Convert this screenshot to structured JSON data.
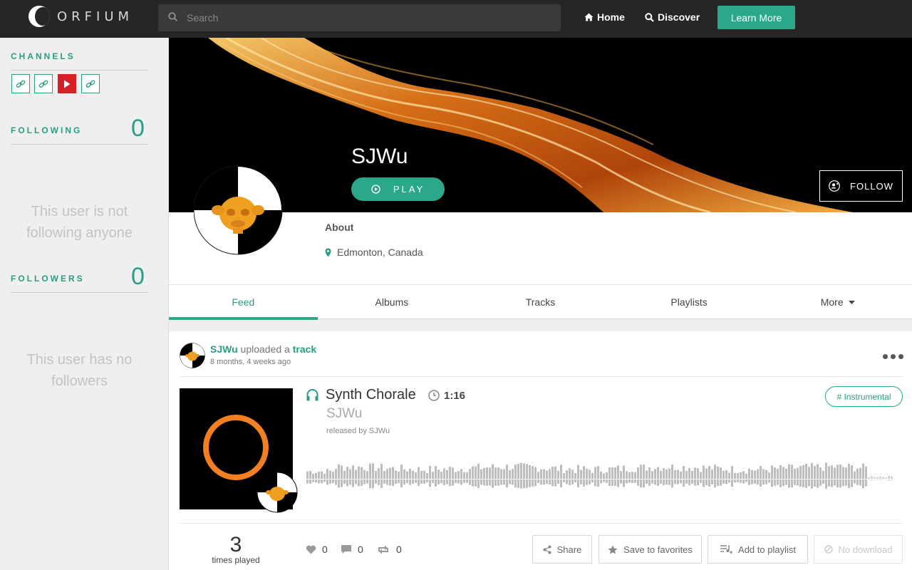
{
  "header": {
    "brand": "ORFIUM",
    "search_placeholder": "Search",
    "nav": [
      {
        "label": "Home",
        "icon": "home-icon"
      },
      {
        "label": "Discover",
        "icon": "search-icon"
      }
    ],
    "cta_label": "Learn More"
  },
  "sidebar": {
    "channels_heading": "CHANNELS",
    "channels": [
      {
        "icon": "link-icon"
      },
      {
        "icon": "link-icon"
      },
      {
        "icon": "youtube-icon"
      },
      {
        "icon": "link-icon"
      }
    ],
    "following_heading": "FOLLOWING",
    "following_count": "0",
    "following_empty": "This user is not following anyone",
    "followers_heading": "FOLLOWERS",
    "followers_count": "0",
    "followers_empty": "This user has no followers"
  },
  "profile": {
    "name": "SJWu",
    "play_label": "PLAY",
    "follow_label": "FOLLOW",
    "about_label": "About",
    "location": "Edmonton, Canada"
  },
  "tabs": [
    {
      "label": "Feed",
      "active": true
    },
    {
      "label": "Albums"
    },
    {
      "label": "Tracks"
    },
    {
      "label": "Playlists"
    },
    {
      "label": "More",
      "dropdown": true
    }
  ],
  "feed": {
    "post": {
      "user": "SJWu",
      "action": "uploaded a",
      "object": "track",
      "time": "8 months, 4 weeks ago",
      "track": {
        "title": "Synth Chorale",
        "duration": "1:16",
        "artist": "SJWu",
        "released_by": "released by SJWu",
        "tag": "# Instrumental"
      },
      "plays": "3",
      "plays_label": "times played",
      "likes": "0",
      "comments": "0",
      "reposts": "0",
      "actions": [
        {
          "label": "Share",
          "icon": "share-icon"
        },
        {
          "label": "Save to favorites",
          "icon": "star-icon"
        },
        {
          "label": "Add to playlist",
          "icon": "add-playlist-icon"
        },
        {
          "label": "No download",
          "icon": "ban-icon",
          "disabled": true
        }
      ]
    }
  },
  "colors": {
    "accent": "#2ba88a",
    "topbar": "#262626",
    "youtube": "#d71f26"
  }
}
